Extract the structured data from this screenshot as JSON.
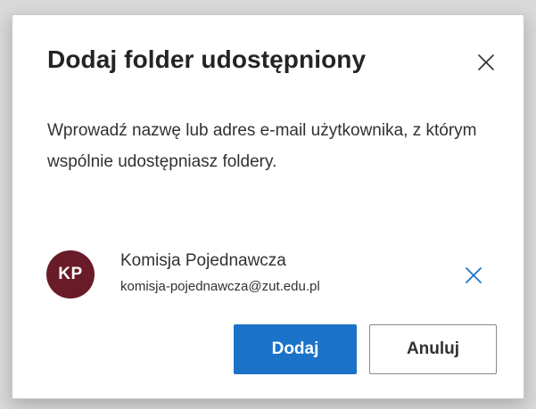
{
  "dialog": {
    "title": "Dodaj folder udostępniony",
    "description": "Wprowadź nazwę lub adres e-mail użytkownika, z którym wspólnie udostępniasz foldery.",
    "close_icon": "close-icon"
  },
  "person": {
    "initials": "KP",
    "name": "Komisja Pojednawcza",
    "email": "komisja-pojednawcza@zut.edu.pl",
    "avatar_color": "#6a1b28",
    "remove_icon": "close-icon"
  },
  "actions": {
    "primary_label": "Dodaj",
    "secondary_label": "Anuluj",
    "primary_color": "#1a73c8"
  }
}
